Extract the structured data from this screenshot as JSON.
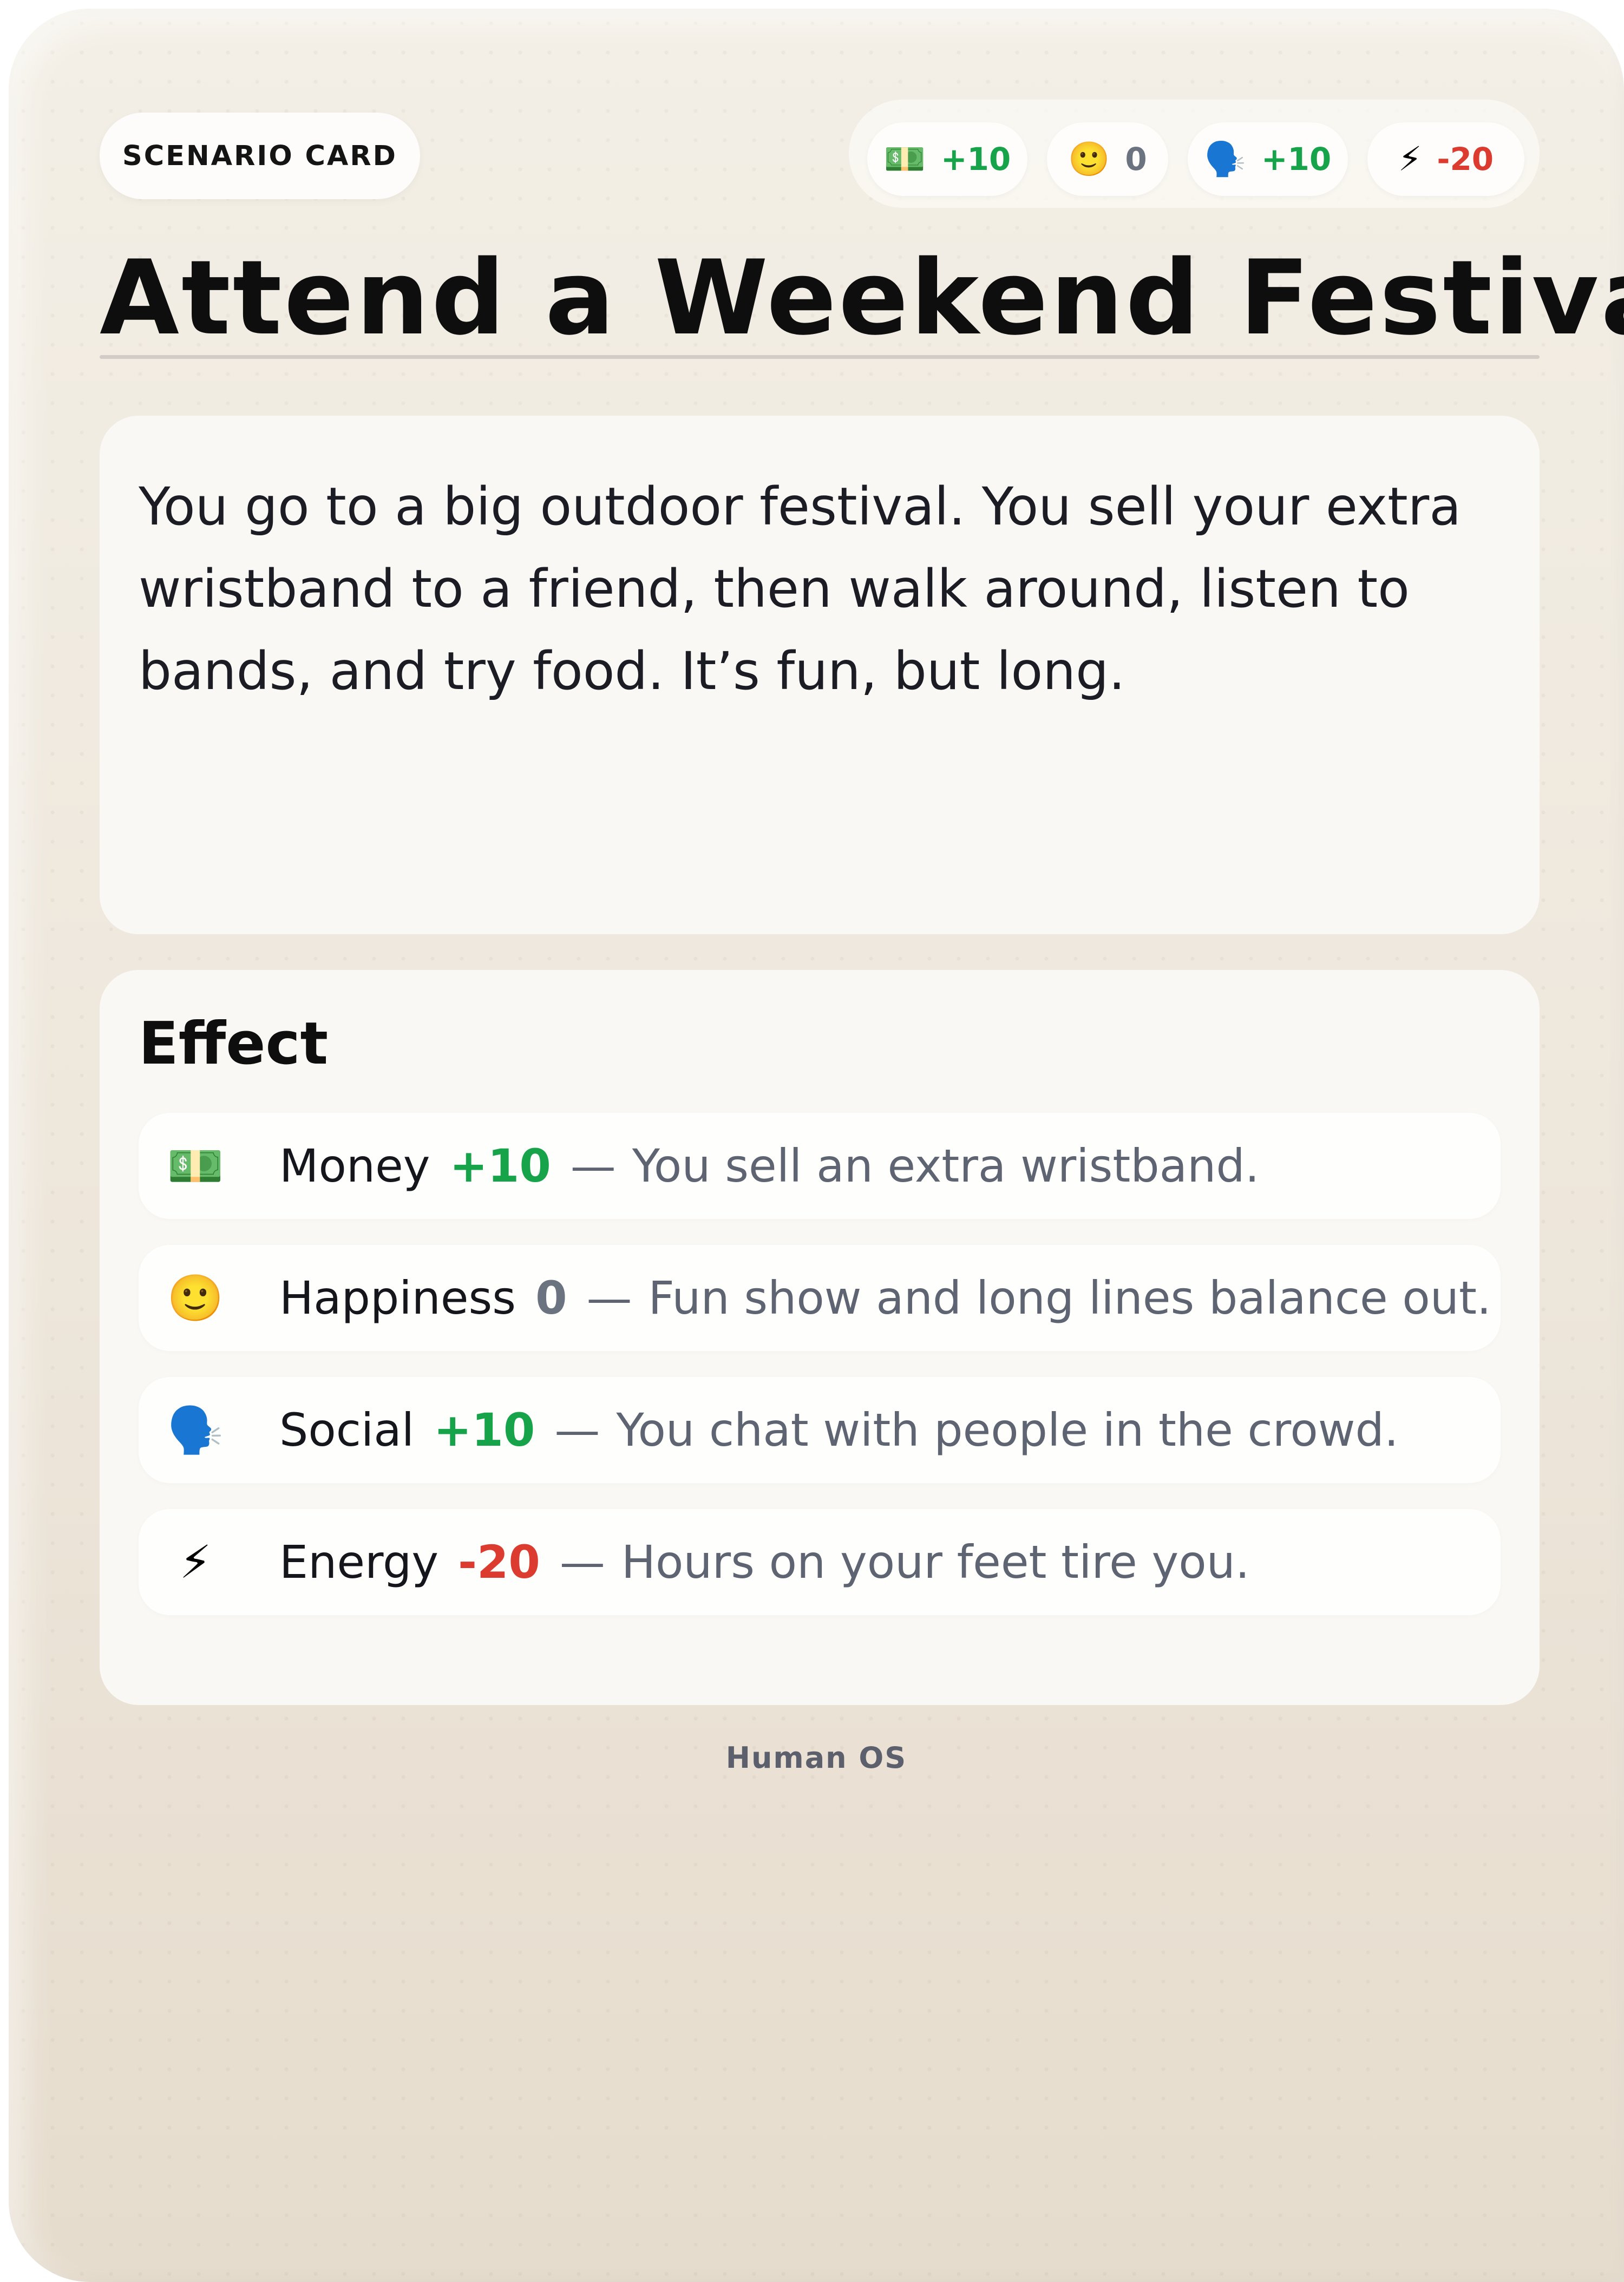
{
  "card": {
    "tag": "SCENARIO CARD",
    "title": "Attend a Weekend Festival",
    "description": "You go to a big outdoor festival. You sell your extra wristband to a friend, then walk around, listen to bands, and try food. It’s fun, but long.",
    "footer": "Human OS"
  },
  "stats": [
    {
      "icon": "💵",
      "icon_name": "money-icon",
      "value": "+10",
      "tone": "positive"
    },
    {
      "icon": "🙂",
      "icon_name": "happiness-icon",
      "value": "0",
      "tone": "neutral"
    },
    {
      "icon": "🗣️",
      "icon_name": "social-icon",
      "value": "+10",
      "tone": "positive"
    },
    {
      "icon": "⚡",
      "icon_name": "energy-icon",
      "value": "-20",
      "tone": "negative"
    }
  ],
  "effect": {
    "heading": "Effect",
    "rows": [
      {
        "icon": "💵",
        "icon_name": "money-icon",
        "label": "Money",
        "delta": "+10",
        "dash": "—",
        "reason": "You sell an extra wristband."
      },
      {
        "icon": "🙂",
        "icon_name": "happiness-icon",
        "label": "Happiness",
        "delta": "0",
        "dash": "—",
        "reason": "Fun show and long lines balance out."
      },
      {
        "icon": "🗣️",
        "icon_name": "social-icon",
        "label": "Social",
        "delta": "+10",
        "dash": "—",
        "reason": "You chat with people in the crowd."
      },
      {
        "icon": "⚡",
        "icon_name": "energy-icon",
        "label": "Energy",
        "delta": "-20",
        "dash": "—",
        "reason": "Hours on your feet tire you."
      }
    ]
  },
  "colors": {
    "positive": "#17a34a",
    "neutral": "#6b7280",
    "negative": "#dc3b2f"
  }
}
